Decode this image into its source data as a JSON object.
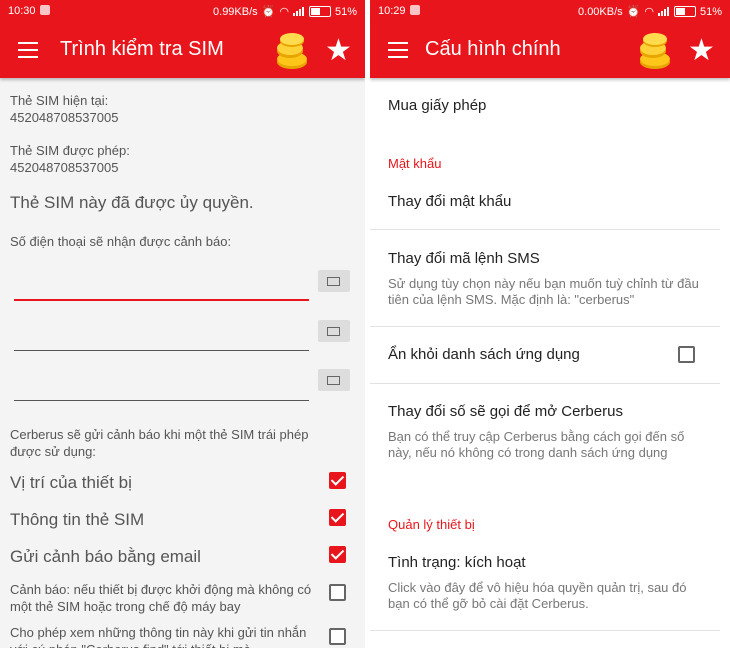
{
  "left": {
    "status": {
      "time": "10:30",
      "speed": "0.99KB/s",
      "battery": "51%"
    },
    "appbar": {
      "title": "Trình kiểm tra SIM"
    },
    "current_sim_label": "Thẻ SIM hiện tại:",
    "current_sim_value": "452048708537005",
    "allowed_sim_label": "Thẻ SIM được phép:",
    "allowed_sim_value": "452048708537005",
    "authorized_text": "Thẻ SIM này đã được ủy quyền.",
    "phones_label": "Số điện thoại sẽ nhận được cảnh báo:",
    "phone_fields": [
      "",
      "",
      ""
    ],
    "alert_desc": "Cerberus sẽ gửi cảnh báo khi một thẻ SIM trái phép được sử dụng:",
    "options": [
      {
        "label": "Vị trí của thiết bị",
        "checked": true
      },
      {
        "label": "Thông tin thẻ SIM",
        "checked": true
      },
      {
        "label": "Gửi cảnh báo bằng email",
        "checked": true
      },
      {
        "label": "Cảnh báo: nếu thiết bị được khởi động mà không có một thẻ SIM hoặc trong chế độ máy bay",
        "checked": false
      },
      {
        "label": "Cho phép xem những thông tin này khi gửi tin nhắn với cú pháp \"Cerberus find\" tới thiết bị mà",
        "checked": false
      }
    ]
  },
  "right": {
    "status": {
      "time": "10:29",
      "speed": "0.00KB/s",
      "battery": "51%"
    },
    "appbar": {
      "title": "Cấu hình chính"
    },
    "buy_license": "Mua giấy phép",
    "cat_password": "Mật khẩu",
    "change_password": "Thay đổi mật khẩu",
    "change_sms_title": "Thay đổi mã lệnh SMS",
    "change_sms_summary": "Sử dụng tùy chọn này nếu bạn muốn tuỳ chỉnh từ đầu tiên của lệnh SMS. Mặc định là: \"cerberus\"",
    "hide_app_title": "Ẩn khỏi danh sách ứng dụng",
    "hide_app_checked": false,
    "change_number_title": "Thay đổi số sẽ gọi để mở Cerberus",
    "change_number_summary": "Bạn có thể truy cập Cerberus bằng cách gọi đến số này, nếu nó không có trong danh sách ứng dụng",
    "cat_device_admin": "Quản lý thiết bị",
    "status_title": "Tình trạng: kích hoạt",
    "status_summary": "Click vào đây để vô hiệu hóa quyền quản trị, sau đó bạn có thể gỡ bỏ cài đặt Cerberus."
  }
}
